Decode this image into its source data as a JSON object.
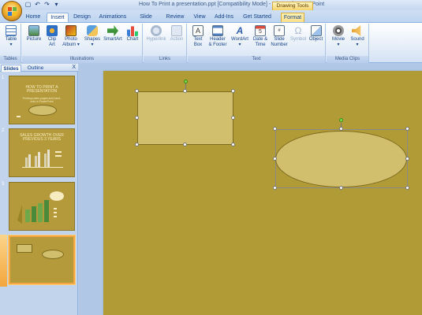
{
  "window": {
    "title": "How To Print a presentation.ppt [Compatibility Mode] - Microsoft PowerPoint",
    "contextual_tab_group": "Drawing Tools"
  },
  "quick_access": {
    "save_icon": "save-icon",
    "undo_icon": "undo-icon",
    "redo_icon": "redo-icon",
    "dropdown": "▾"
  },
  "tabs": [
    "Home",
    "Insert",
    "Design",
    "Animations",
    "Slide Show",
    "Review",
    "View",
    "Add-Ins",
    "Get Started",
    "Format"
  ],
  "active_tab": "Insert",
  "ribbon": {
    "groups": {
      "tables": "Tables",
      "illustrations": "Illustrations",
      "links": "Links",
      "text": "Text",
      "media": "Media Clips"
    },
    "commands": {
      "table": "Table\n▾",
      "picture": "Picture",
      "clip_art": "Clip\nArt",
      "photo_album": "Photo\nAlbum ▾",
      "shapes": "Shapes\n▾",
      "smartart": "SmartArt",
      "chart": "Chart",
      "hyperlink": "Hyperlink",
      "action": "Action",
      "text_box": "Text\nBox",
      "header_footer": "Header\n& Footer",
      "wordart": "WordArt\n▾",
      "date_time": "Date &\nTime",
      "slide_number": "Slide\nNumber",
      "symbol": "Symbol",
      "object": "Object",
      "movie": "Movie\n▾",
      "sound": "Sound\n▾"
    }
  },
  "pane": {
    "tabs": [
      "Slides",
      "Outline"
    ],
    "close": "X",
    "thumbnails": [
      {
        "number": "1",
        "title": "HOW TO PRINT A\nPRESENTATION",
        "subtitle": "Printing notes pages and hand-\nouts in PowerPoint"
      },
      {
        "number": "2",
        "title": "SALES GROWTH OVER\nPREVIOUS 3 YEARS",
        "subtitle": ""
      },
      {
        "number": "3",
        "title": "",
        "subtitle": ""
      },
      {
        "number": "4",
        "title": "",
        "subtitle": ""
      }
    ]
  },
  "colors": {
    "slide_background": "#b09b37",
    "shape_fill": "#d1bf6d",
    "selection_handle": "#ffffff",
    "rotation_handle": "#7de04a",
    "ribbon_text": "#15428b"
  }
}
